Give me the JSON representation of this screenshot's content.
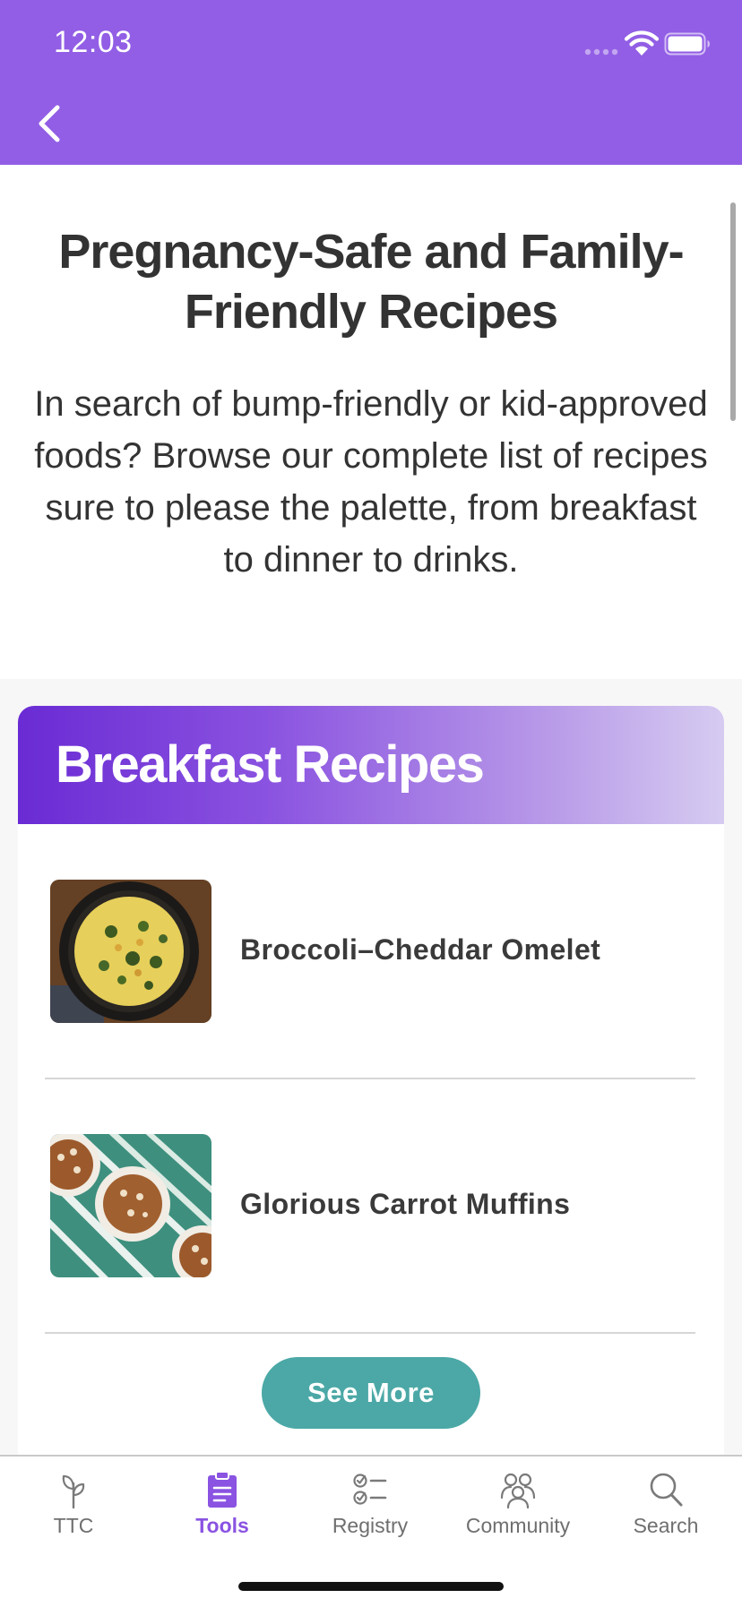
{
  "status_bar": {
    "time": "12:03",
    "icons": [
      "cellular-signal-icon",
      "wifi-icon",
      "battery-icon"
    ]
  },
  "nav": {
    "back_icon": "chevron-left-icon"
  },
  "intro": {
    "title": "Pregnancy-Safe and Family-Friendly Recipes",
    "description": "In search of bump-friendly or kid-approved foods? Browse our complete list of recipes sure to please the palette, from breakfast to dinner to drinks."
  },
  "section": {
    "title": "Breakfast Recipes",
    "recipes": [
      {
        "name": "Broccoli–Cheddar Omelet",
        "image": "omelet-skillet-photo"
      },
      {
        "name": "Glorious Carrot Muffins",
        "image": "carrot-muffins-photo"
      }
    ],
    "see_more_label": "See More"
  },
  "tabbar": {
    "tabs": [
      {
        "label": "TTC",
        "icon": "sprout-icon",
        "active": false
      },
      {
        "label": "Tools",
        "icon": "clipboard-icon",
        "active": true
      },
      {
        "label": "Registry",
        "icon": "checklist-icon",
        "active": false
      },
      {
        "label": "Community",
        "icon": "people-group-icon",
        "active": false
      },
      {
        "label": "Search",
        "icon": "search-icon",
        "active": false
      }
    ]
  },
  "colors": {
    "brand_purple": "#925ee5",
    "active_tab": "#8a53e2",
    "button_teal": "#4ba8a6",
    "header_gradient_start": "#6a2bd4",
    "header_gradient_end": "#d6cbf1"
  }
}
